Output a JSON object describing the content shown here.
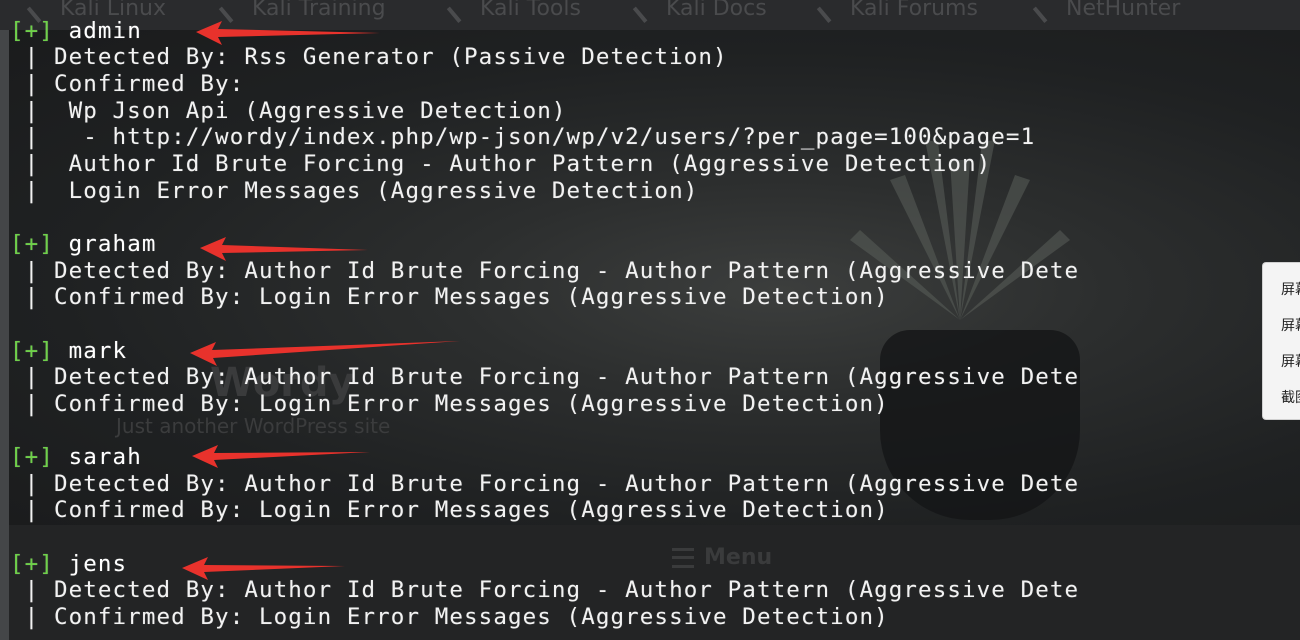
{
  "browser": {
    "bookmarks": [
      "Kali Linux",
      "Kali Training",
      "Kali Tools",
      "Kali Docs",
      "Kali Forums",
      "NetHunter"
    ]
  },
  "site": {
    "title": "Wordy",
    "tagline": "Just another WordPress site",
    "menu_label": "Menu"
  },
  "terminal": {
    "users": [
      {
        "prefix": "[+]",
        "name": "admin",
        "lines": [
          " | Detected By: Rss Generator (Passive Detection)",
          " | Confirmed By:",
          " |  Wp Json Api (Aggressive Detection)",
          " |   - http://wordy/index.php/wp-json/wp/v2/users/?per_page=100&page=1",
          " |  Author Id Brute Forcing - Author Pattern (Aggressive Detection)",
          " |  Login Error Messages (Aggressive Detection)"
        ]
      },
      {
        "prefix": "[+]",
        "name": "graham",
        "lines": [
          " | Detected By: Author Id Brute Forcing - Author Pattern (Aggressive Dete",
          " | Confirmed By: Login Error Messages (Aggressive Detection)"
        ]
      },
      {
        "prefix": "[+]",
        "name": "mark",
        "lines": [
          " | Detected By: Author Id Brute Forcing - Author Pattern (Aggressive Dete",
          " | Confirmed By: Login Error Messages (Aggressive Detection)"
        ]
      },
      {
        "prefix": "[+]",
        "name": "sarah",
        "lines": [
          " | Detected By: Author Id Brute Forcing - Author Pattern (Aggressive Dete",
          " | Confirmed By: Login Error Messages (Aggressive Detection)"
        ]
      },
      {
        "prefix": "[+]",
        "name": "jens",
        "lines": [
          " | Detected By: Author Id Brute Forcing - Author Pattern (Aggressive Dete",
          " | Confirmed By: Login Error Messages (Aggressive Detection)"
        ]
      }
    ]
  },
  "context_menu": {
    "items": [
      "屏幕",
      "屏幕",
      "屏幕",
      "截图"
    ]
  },
  "colors": {
    "prompt_green": "#6fd14a",
    "terminal_text": "#f2f2f2",
    "annotation_arrow": "#e8322c"
  }
}
